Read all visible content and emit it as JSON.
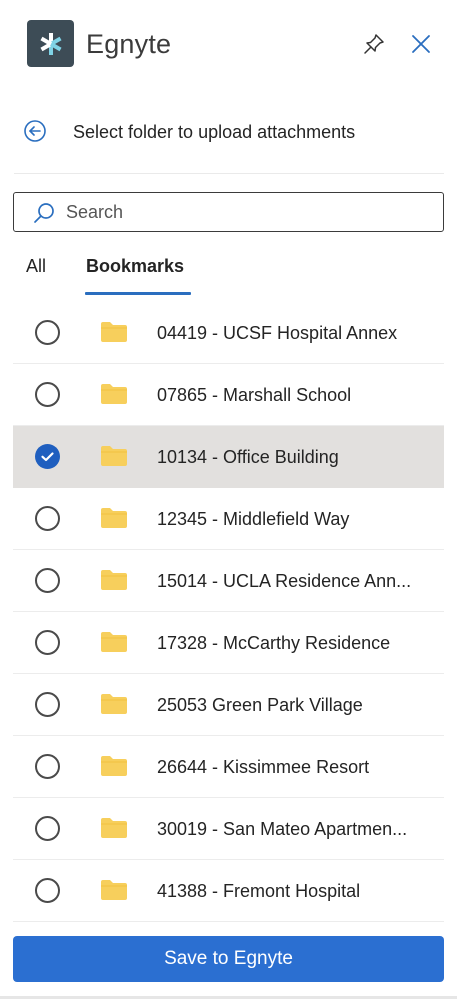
{
  "header": {
    "app_name": "Egnyte",
    "logo_icon": "egnyte-logo-icon",
    "pin_icon": "pin-icon",
    "close_icon": "close-icon"
  },
  "subheader": {
    "back_icon": "back-arrow-circle-icon",
    "title": "Select folder to upload attachments"
  },
  "search": {
    "placeholder": "Search",
    "value": ""
  },
  "tabs": [
    {
      "label": "All",
      "active": false
    },
    {
      "label": "Bookmarks",
      "active": true
    }
  ],
  "folders": [
    {
      "name": "04419 - UCSF Hospital Annex",
      "selected": false
    },
    {
      "name": "07865 - Marshall School",
      "selected": false
    },
    {
      "name": "10134 - Office Building",
      "selected": true
    },
    {
      "name": "12345 - Middlefield Way",
      "selected": false
    },
    {
      "name": "15014 - UCLA Residence Ann...",
      "selected": false
    },
    {
      "name": "17328 - McCarthy Residence",
      "selected": false
    },
    {
      "name": "25053 Green Park Village",
      "selected": false
    },
    {
      "name": "26644 - Kissimmee Resort",
      "selected": false
    },
    {
      "name": "30019 - San Mateo Apartmen...",
      "selected": false
    },
    {
      "name": "41388 - Fremont Hospital",
      "selected": false
    }
  ],
  "actions": {
    "save_label": "Save to Egnyte"
  },
  "colors": {
    "accent": "#2b6fd1",
    "radio_checked": "#1f5fbf",
    "selected_row": "#e2e0de",
    "folder": "#f7cf5c",
    "logo_bg": "#3d4c56"
  }
}
